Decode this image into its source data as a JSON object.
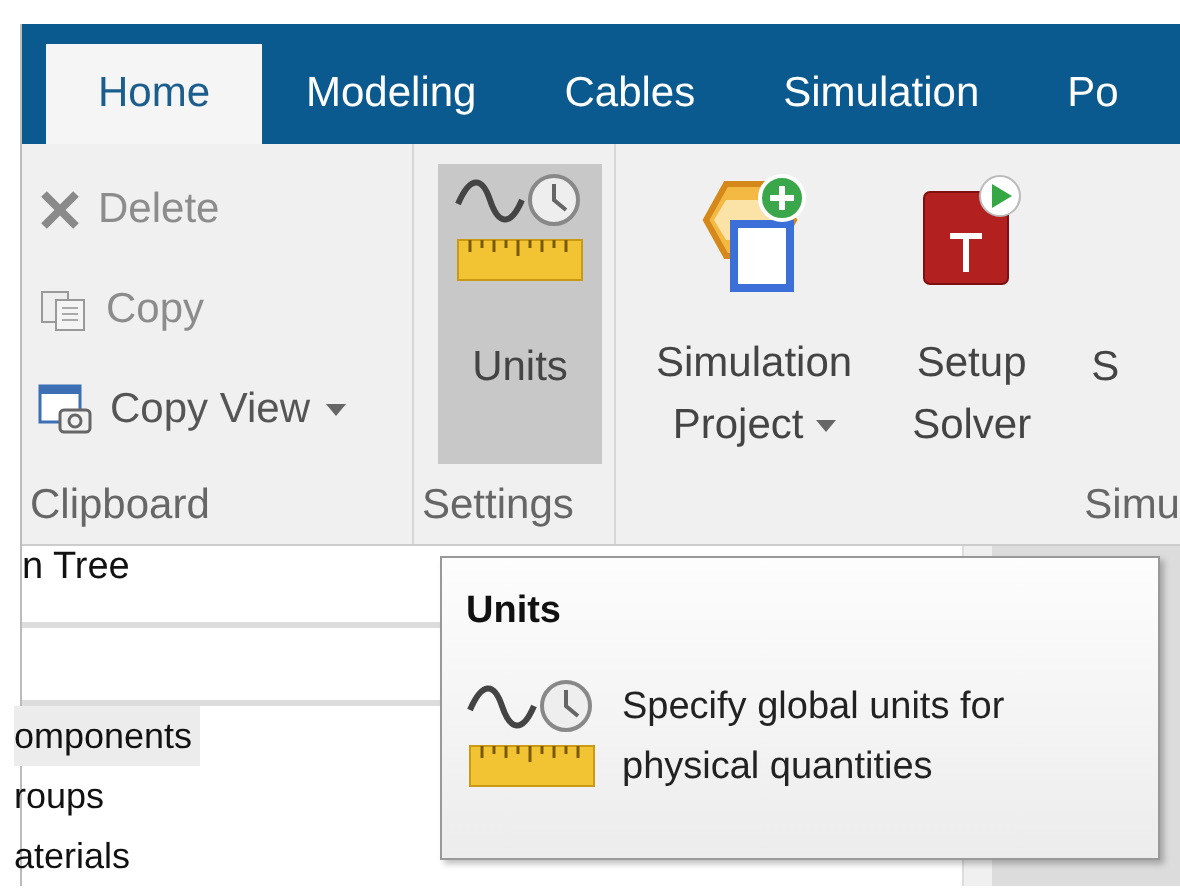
{
  "tabs": [
    {
      "label": "Home",
      "selected": true
    },
    {
      "label": "Modeling",
      "selected": false
    },
    {
      "label": "Cables",
      "selected": false
    },
    {
      "label": "Simulation",
      "selected": false
    },
    {
      "label": "Po",
      "selected": false
    }
  ],
  "ribbon": {
    "groups": [
      {
        "label": "Clipboard",
        "kind": "small",
        "items": [
          {
            "label": "Delete",
            "disabled": true
          },
          {
            "label": "Copy",
            "disabled": true
          },
          {
            "label": "Copy View",
            "disabled": false,
            "dropdown": true
          }
        ]
      },
      {
        "label": "Settings",
        "kind": "large",
        "items": [
          {
            "lines": [
              "Units"
            ],
            "highlighted": true
          }
        ]
      },
      {
        "label": "Simu",
        "kind": "large",
        "items": [
          {
            "lines": [
              "Simulation",
              "Project"
            ],
            "highlighted": false,
            "dropdown": true
          },
          {
            "lines": [
              "Setup",
              "Solver"
            ],
            "highlighted": false
          },
          {
            "lines": [
              "S"
            ],
            "highlighted": false
          }
        ]
      }
    ]
  },
  "tree": {
    "title": "n Tree",
    "items": [
      {
        "label": "omponents",
        "selected": true
      },
      {
        "label": "roups",
        "selected": false
      },
      {
        "label": "aterials",
        "selected": false
      }
    ]
  },
  "tooltip": {
    "title": "Units",
    "text": "Specify global units for physical quantities"
  }
}
